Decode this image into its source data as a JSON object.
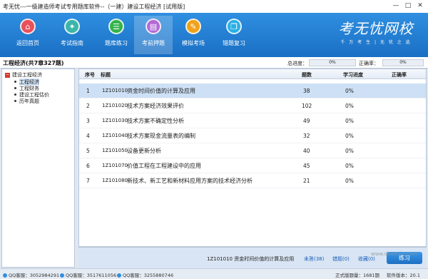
{
  "window": {
    "title": "考无忧---一级建造师考试专用题库软件--（一建）建设工程经济 [试用版]",
    "minimize": "—",
    "maximize": "□",
    "close": "✕"
  },
  "toolbar": {
    "buttons": [
      {
        "label": "返回首页",
        "icon": "home-icon",
        "color": "#e8505b"
      },
      {
        "label": "考试指南",
        "icon": "compass-icon",
        "color": "#3bb6a9"
      },
      {
        "label": "题库练习",
        "icon": "list-icon",
        "color": "#33b34a"
      },
      {
        "label": "考前押题",
        "icon": "document-icon",
        "color": "#b26ad6"
      },
      {
        "label": "模拟考场",
        "icon": "pencil-icon",
        "color": "#f0a21c"
      },
      {
        "label": "错题复习",
        "icon": "clipboard-icon",
        "color": "#2ab0e6"
      }
    ],
    "active_index": 3
  },
  "brand": {
    "name": "考无忧网校",
    "slogan": "千 万 考 生 | 无 忧 之 选"
  },
  "section": {
    "title": "工程经济(共7章327题)",
    "progress_label": "总进度：",
    "progress_value": "0%",
    "progress_fraction": 0.0,
    "accuracy_label": "正确率：",
    "accuracy_value": "0%",
    "accuracy_fraction": 0.0
  },
  "tree": {
    "root": "建设工程经济",
    "children": [
      "工程经济",
      "工程财务",
      "建设工程估价",
      "历年真题"
    ],
    "selected_index": 0
  },
  "table": {
    "headers": [
      "序号",
      "标题",
      "题数",
      "学习进度",
      "正确率"
    ],
    "rows": [
      {
        "no": "1",
        "code": "1Z101010",
        "title": "资金时间价值的计算及应用",
        "count": "38",
        "progress": "0%",
        "accuracy": ""
      },
      {
        "no": "2",
        "code": "1Z101020",
        "title": "技术方案经济效果评价",
        "count": "102",
        "progress": "0%",
        "accuracy": ""
      },
      {
        "no": "3",
        "code": "1Z101030",
        "title": "技术方案不确定性分析",
        "count": "49",
        "progress": "0%",
        "accuracy": ""
      },
      {
        "no": "4",
        "code": "1Z101040",
        "title": "技术方案现金流量表的编制",
        "count": "32",
        "progress": "0%",
        "accuracy": ""
      },
      {
        "no": "5",
        "code": "1Z101050",
        "title": "设备更新分析",
        "count": "40",
        "progress": "0%",
        "accuracy": ""
      },
      {
        "no": "6",
        "code": "1Z101070",
        "title": "价值工程在工程建设中的应用",
        "count": "45",
        "progress": "0%",
        "accuracy": ""
      },
      {
        "no": "7",
        "code": "1Z101080",
        "title": "新技术、新工艺和新材料应用方案的技术经济分析",
        "count": "21",
        "progress": "0%",
        "accuracy": ""
      }
    ],
    "selected_index": 0
  },
  "bottom": {
    "current": "1Z101010 资金时间价值的计算及应用",
    "unanswered": "未答(38)",
    "wrong": "错题(0)",
    "collected": "收藏(0)",
    "practice_button": "练习"
  },
  "status": {
    "qq1": "QQ客服：3052984291",
    "qq2": "QQ客服：3517611056",
    "qq3": "QQ客服：3255880746",
    "total": "正式版题量：1681题",
    "version": "软件版本：20.1"
  },
  "watermark": "www.downxia.com"
}
